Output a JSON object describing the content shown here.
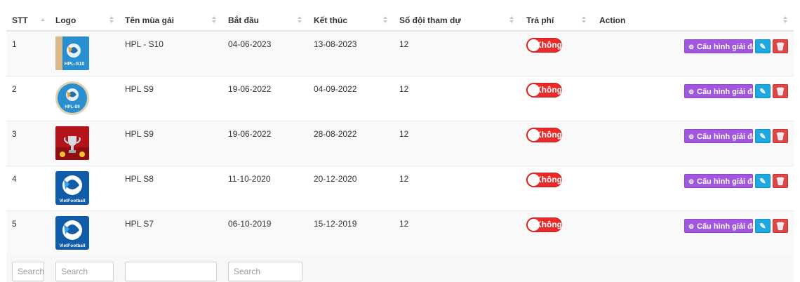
{
  "columns": [
    {
      "label": "STT"
    },
    {
      "label": "Logo"
    },
    {
      "label": "Tên mùa gải"
    },
    {
      "label": "Bắt đầu"
    },
    {
      "label": "Kết thúc"
    },
    {
      "label": "Số đội tham dự"
    },
    {
      "label": "Trả phí"
    },
    {
      "label": "Action"
    }
  ],
  "rows": [
    {
      "stt": "1",
      "logo_icon": "hpl-s10-logo-icon",
      "logo_text": "HPL-S10",
      "name": "HPL - S10",
      "start": "04-06-2023",
      "end": "13-08-2023",
      "teams": "12",
      "paid": "Không"
    },
    {
      "stt": "2",
      "logo_icon": "hpl-s9-logo-icon",
      "logo_text": "HPL-S9",
      "name": "HPL S9",
      "start": "19-06-2022",
      "end": "04-09-2022",
      "teams": "12",
      "paid": "Không"
    },
    {
      "stt": "3",
      "logo_icon": "trophy-logo-icon",
      "logo_text": "",
      "name": "HPL S9",
      "start": "19-06-2022",
      "end": "28-08-2022",
      "teams": "12",
      "paid": "Không"
    },
    {
      "stt": "4",
      "logo_icon": "vietfootball-logo-icon",
      "logo_text": "VietFootball",
      "name": "HPL S8",
      "start": "11-10-2020",
      "end": "20-12-2020",
      "teams": "12",
      "paid": "Không"
    },
    {
      "stt": "5",
      "logo_icon": "vietfootball-logo-icon",
      "logo_text": "VietFootball",
      "name": "HPL S7",
      "start": "06-10-2019",
      "end": "15-12-2019",
      "teams": "12",
      "paid": "Không"
    }
  ],
  "actions": {
    "config_label": "Cấu hình giải đấu",
    "config_icon": "gears-icon",
    "edit_icon": "edit-icon",
    "delete_icon": "trash-icon"
  },
  "filters": {
    "stt_placeholder": "Search",
    "logo_placeholder": "Search",
    "name_placeholder": "",
    "start_placeholder": "Search"
  },
  "colors": {
    "toggle_off": "#e52b2b",
    "config_button": "#a156de",
    "edit_button": "#1fa8e0",
    "delete_button": "#e04646"
  }
}
